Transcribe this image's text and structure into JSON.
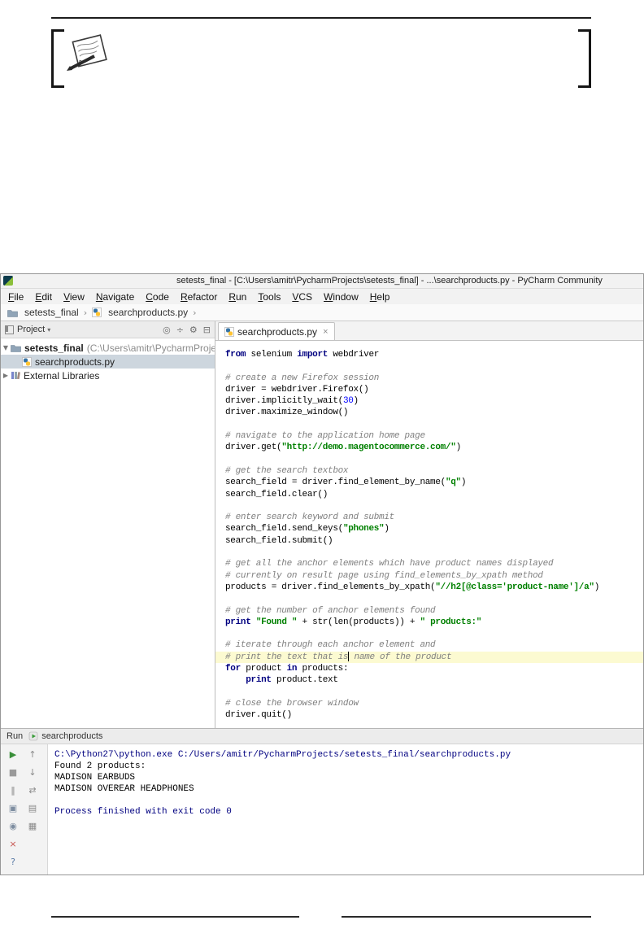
{
  "colors": {
    "keyword": "#000080",
    "string": "#008000",
    "comment": "#808080",
    "number": "#0000ff",
    "caret_line_bg": "#FCFAD1",
    "selection_bg": "#CDD6DE",
    "console_system": "#000080",
    "console_stdout": "#000000"
  },
  "icons": {
    "chevron_down": "▼",
    "chevron_right": "▶",
    "breadcrumb_sep": "›",
    "panel_caret": "▾",
    "tab_close": "×"
  },
  "ide": {
    "title_bar": {
      "title": "setests_final - [C:\\Users\\amitr\\PycharmProjects\\setests_final] - ...\\searchproducts.py - PyCharm Community"
    },
    "menu": [
      "File",
      "Edit",
      "View",
      "Navigate",
      "Code",
      "Refactor",
      "Run",
      "Tools",
      "VCS",
      "Window",
      "Help"
    ],
    "breadcrumbs": {
      "project": "setests_final",
      "file": "searchproducts.py",
      "separator": "›"
    },
    "project": {
      "header": {
        "title": "Project",
        "toolbar_icons": [
          {
            "name": "scroll-from-source-icon",
            "glyph": "◎"
          },
          {
            "name": "collapse-all-icon",
            "glyph": "÷"
          },
          {
            "name": "settings-icon",
            "glyph": "⚙"
          },
          {
            "name": "hide-panel-icon",
            "glyph": "⊟"
          }
        ]
      },
      "tree": {
        "root_label": "setests_final",
        "root_path": "(C:\\Users\\amitr\\PycharmProjects\\sete",
        "file_label": "searchproducts.py",
        "libraries_label": "External Libraries"
      }
    },
    "editor": {
      "tab": {
        "label": "searchproducts.py"
      },
      "code": [
        {
          "t": [
            [
              "kw",
              "from"
            ],
            [
              "p",
              " selenium "
            ],
            [
              "kw",
              "import"
            ],
            [
              "p",
              " webdriver"
            ]
          ]
        },
        {
          "t": []
        },
        {
          "t": [
            [
              "c",
              "# create a new Firefox session"
            ]
          ]
        },
        {
          "t": [
            [
              "p",
              "driver = webdriver.Firefox()"
            ]
          ]
        },
        {
          "t": [
            [
              "p",
              "driver.implicitly_wait("
            ],
            [
              "n",
              "30"
            ],
            [
              "p",
              ")"
            ]
          ]
        },
        {
          "t": [
            [
              "p",
              "driver.maximize_window()"
            ]
          ]
        },
        {
          "t": []
        },
        {
          "t": [
            [
              "c",
              "# navigate to the application home page"
            ]
          ]
        },
        {
          "t": [
            [
              "p",
              "driver.get("
            ],
            [
              "s",
              "\"http://demo.magentocommerce.com/\""
            ],
            [
              "p",
              ")"
            ]
          ]
        },
        {
          "t": []
        },
        {
          "t": [
            [
              "c",
              "# get the search textbox"
            ]
          ]
        },
        {
          "t": [
            [
              "p",
              "search_field = driver.find_element_by_name("
            ],
            [
              "s",
              "\"q\""
            ],
            [
              "p",
              ")"
            ]
          ]
        },
        {
          "t": [
            [
              "p",
              "search_field.clear()"
            ]
          ]
        },
        {
          "t": []
        },
        {
          "t": [
            [
              "c",
              "# enter search keyword and submit"
            ]
          ]
        },
        {
          "t": [
            [
              "p",
              "search_field.send_keys("
            ],
            [
              "s",
              "\"phones\""
            ],
            [
              "p",
              ")"
            ]
          ]
        },
        {
          "t": [
            [
              "p",
              "search_field.submit()"
            ]
          ]
        },
        {
          "t": []
        },
        {
          "t": [
            [
              "c",
              "# get all the anchor elements which have product names displayed"
            ]
          ]
        },
        {
          "t": [
            [
              "c",
              "# currently on result page using find_elements_by_xpath method"
            ]
          ]
        },
        {
          "t": [
            [
              "p",
              "products = driver.find_elements_by_xpath("
            ],
            [
              "s",
              "\"//h2[@class='product-name']/a\""
            ],
            [
              "p",
              ")"
            ]
          ]
        },
        {
          "t": []
        },
        {
          "t": [
            [
              "c",
              "# get the number of anchor elements found"
            ]
          ]
        },
        {
          "t": [
            [
              "kw",
              "print"
            ],
            [
              "p",
              " "
            ],
            [
              "s",
              "\"Found \""
            ],
            [
              "p",
              " + str(len(products)) + "
            ],
            [
              "s",
              "\" products:\""
            ]
          ]
        },
        {
          "t": []
        },
        {
          "t": [
            [
              "c",
              "# iterate through each anchor element and"
            ]
          ]
        },
        {
          "caret": true,
          "t": [
            [
              "c",
              "# print the text that is"
            ],
            [
              "caret",
              ""
            ],
            [
              "c",
              " name of the product"
            ]
          ]
        },
        {
          "t": [
            [
              "kw",
              "for"
            ],
            [
              "p",
              " product "
            ],
            [
              "kw",
              "in"
            ],
            [
              "p",
              " products:"
            ]
          ]
        },
        {
          "t": [
            [
              "p",
              "    "
            ],
            [
              "kw",
              "print"
            ],
            [
              "p",
              " product.text"
            ]
          ]
        },
        {
          "t": []
        },
        {
          "t": [
            [
              "c",
              "# close the browser window"
            ]
          ]
        },
        {
          "t": [
            [
              "p",
              "driver.quit()"
            ]
          ]
        }
      ]
    },
    "run": {
      "header": {
        "label": "Run",
        "tab": "searchproducts"
      },
      "toolbar_col1": [
        {
          "name": "rerun-icon",
          "glyph": "▶",
          "color": "#3a8f3a"
        },
        {
          "name": "stop-icon",
          "glyph": "■",
          "color": "#9a9a9a"
        },
        {
          "name": "pause-output-icon",
          "glyph": "‖",
          "color": "#8a8a8a"
        },
        {
          "name": "restore-layout-icon",
          "glyph": "▣",
          "color": "#7d8da0"
        },
        {
          "name": "pin-tab-icon",
          "glyph": "◉",
          "color": "#7d8da0"
        },
        {
          "name": "close-icon",
          "glyph": "×",
          "color": "#c75450"
        },
        {
          "name": "help-icon",
          "glyph": "?",
          "color": "#5a7ba6"
        }
      ],
      "toolbar_col2": [
        {
          "name": "up-stack-icon",
          "glyph": "↑",
          "color": "#8a8a8a"
        },
        {
          "name": "down-stack-icon",
          "glyph": "↓",
          "color": "#8a8a8a"
        },
        {
          "name": "soft-wrap-icon",
          "glyph": "⇄",
          "color": "#8a8a8a"
        },
        {
          "name": "print-icon",
          "glyph": "▤",
          "color": "#8a8a8a"
        },
        {
          "name": "clear-all-icon",
          "glyph": "▦",
          "color": "#8a8a8a"
        }
      ],
      "console": [
        {
          "type": "system",
          "text": "C:\\Python27\\python.exe C:/Users/amitr/PycharmProjects/setests_final/searchproducts.py"
        },
        {
          "type": "stdout",
          "text": "Found 2 products:"
        },
        {
          "type": "stdout",
          "text": "MADISON EARBUDS"
        },
        {
          "type": "stdout",
          "text": "MADISON OVEREAR HEADPHONES"
        },
        {
          "type": "stdout",
          "text": ""
        },
        {
          "type": "system",
          "text": "Process finished with exit code 0"
        }
      ]
    }
  }
}
